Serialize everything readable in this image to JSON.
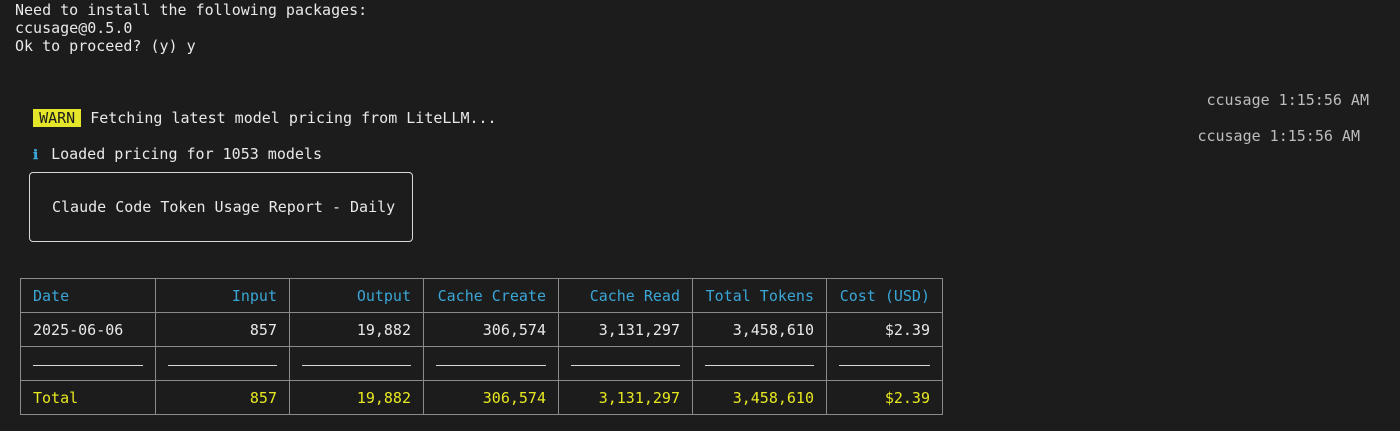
{
  "terminal": {
    "npx_prompt": {
      "line1": "Need to install the following packages:",
      "line2": "ccusage@0.5.0",
      "line3": "Ok to proceed? (y) y"
    },
    "logs": [
      {
        "level": "WARN",
        "message": "Fetching latest model pricing from LiteLLM...",
        "meta": "ccusage 1:15:56 AM"
      },
      {
        "icon": "info-icon",
        "icon_glyph": "ℹ",
        "message": "Loaded pricing for 1053 models",
        "meta": "ccusage 1:15:56 AM"
      }
    ],
    "report_title": "Claude Code Token Usage Report - Daily",
    "table": {
      "headers": [
        "Date",
        "Input",
        "Output",
        "Cache Create",
        "Cache Read",
        "Total Tokens",
        "Cost (USD)"
      ],
      "rows": [
        [
          "2025-06-06",
          "857",
          "19,882",
          "306,574",
          "3,131,297",
          "3,458,610",
          "$2.39"
        ]
      ],
      "total": [
        "Total",
        "857",
        "19,882",
        "306,574",
        "3,131,297",
        "3,458,610",
        "$2.39"
      ]
    }
  },
  "colors": {
    "background": "#1c1c1c",
    "header_cyan": "#3aa6d6",
    "total_yellow": "#e8e820",
    "warn_badge": "#e5e52a"
  }
}
